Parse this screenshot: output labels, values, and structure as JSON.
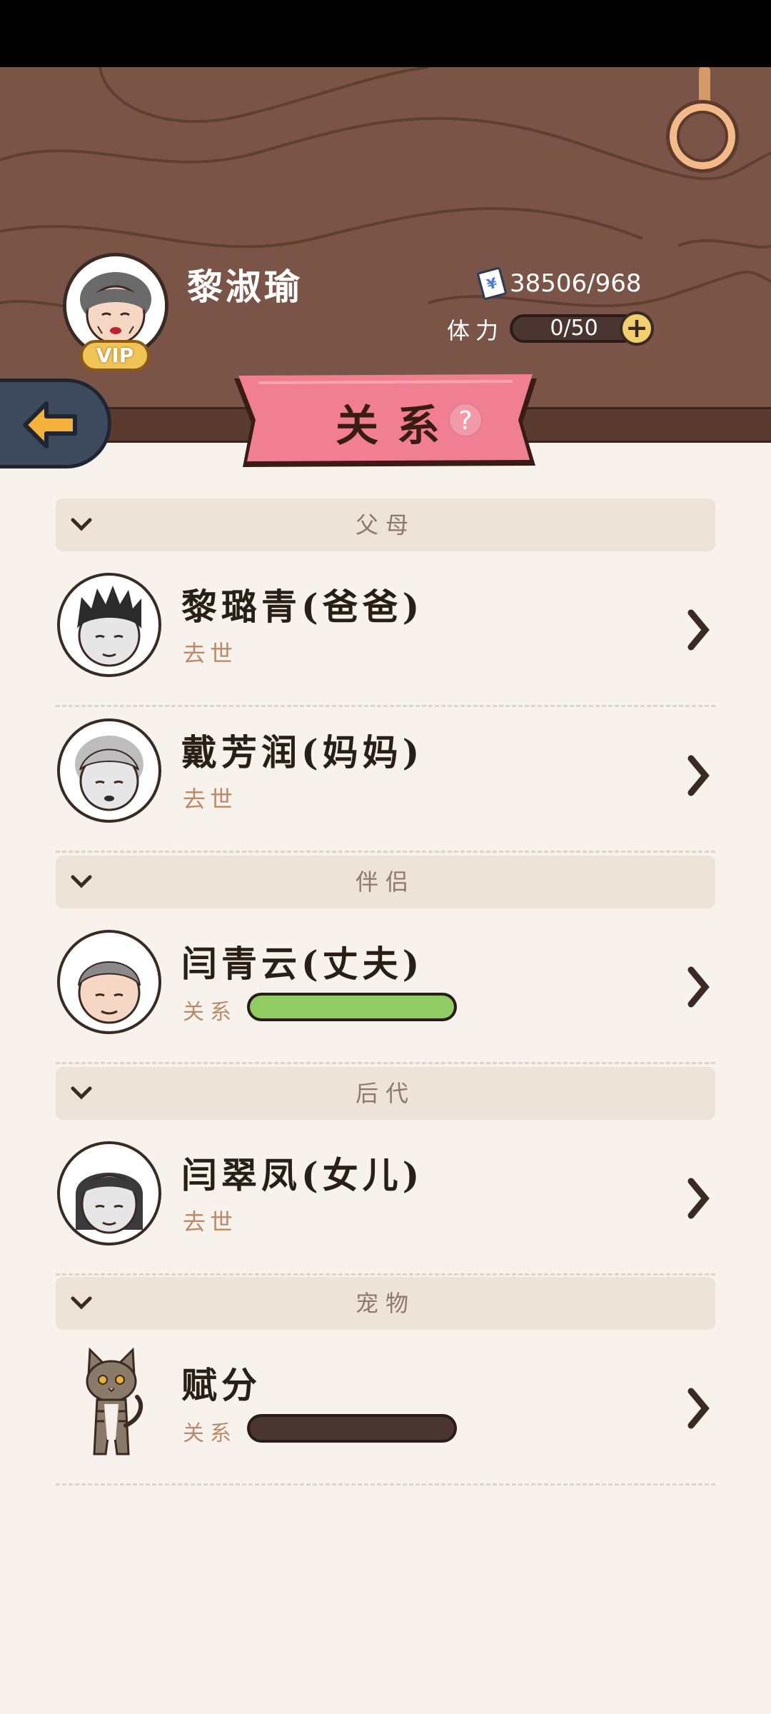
{
  "header": {
    "player_name": "黎淑瑜",
    "vip_label": "VIP",
    "money": "38506/968",
    "stamina_label": "体力",
    "stamina_value": "0/50",
    "stamina_add": "+"
  },
  "page": {
    "title": "关系",
    "help": "?"
  },
  "sections": [
    {
      "title": "父母",
      "members": [
        {
          "name": "黎璐青(爸爸)",
          "status": "去世"
        },
        {
          "name": "戴芳润(妈妈)",
          "status": "去世"
        }
      ]
    },
    {
      "title": "伴侣",
      "members": [
        {
          "name": "闫青云(丈夫)",
          "relation_label": "关系",
          "relation_level": 1.0
        }
      ]
    },
    {
      "title": "后代",
      "members": [
        {
          "name": "闫翠凤(女儿)",
          "status": "去世"
        }
      ]
    },
    {
      "title": "宠物",
      "members": [
        {
          "name": "赋分",
          "relation_label": "关系",
          "relation_level": 0.0
        }
      ]
    }
  ],
  "colors": {
    "header_wood": "#7a5547",
    "ribbon_pink": "#f07f93",
    "relation_green": "#8fcc63",
    "background": "#f7f3ec"
  },
  "icons": [
    "back-arrow-icon",
    "help-icon",
    "chevron-down-icon",
    "chevron-right-icon",
    "money-icon",
    "plus-icon"
  ]
}
